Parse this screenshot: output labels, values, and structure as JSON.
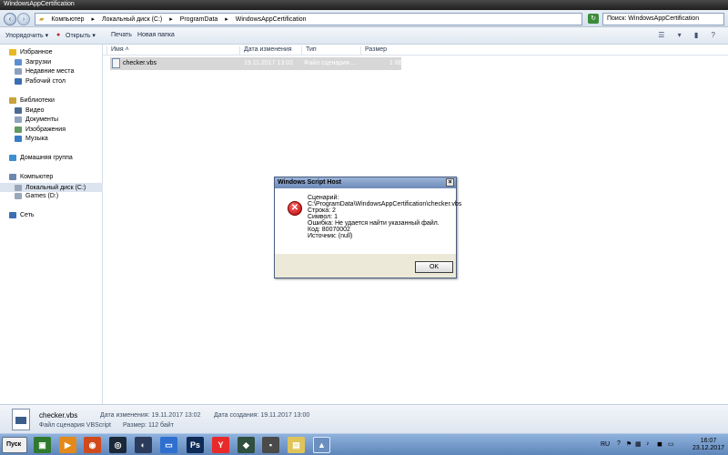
{
  "window": {
    "title": "WindowsAppCertification"
  },
  "address": {
    "crumbs": [
      "Компьютер",
      "Локальный диск (C:)",
      "ProgramData",
      "WindowsAppCertification"
    ],
    "search_placeholder": "Поиск: WindowsAppCertification"
  },
  "toolbar": {
    "organize": "Упорядочить ▾",
    "open": "Открыть ▾",
    "print": "Печать",
    "new_folder": "Новая папка"
  },
  "nav": {
    "favorites": "Избранное",
    "downloads": "Загрузки",
    "recent": "Недавние места",
    "desktop": "Рабочий стол",
    "libraries": "Библиотеки",
    "video": "Видео",
    "documents": "Документы",
    "images": "Изображения",
    "music": "Музыка",
    "homegroup": "Домашняя группа",
    "computer": "Компьютер",
    "local_disk": "Локальный диск (C:)",
    "games": "Games (D:)",
    "network": "Сеть"
  },
  "columns": {
    "name": "Имя",
    "date": "Дата изменения",
    "type": "Тип",
    "size": "Размер"
  },
  "file": {
    "name": "checker.vbs",
    "date": "19.11.2017 13:02",
    "type": "Файл сценария ...",
    "size": "1 КБ"
  },
  "dialog": {
    "title": "Windows Script Host",
    "close": "×",
    "script_label": "Сценарий:",
    "script_path": "C:\\ProgramData\\WindowsAppCertification\\checker.vbs",
    "line": "Строка:   2",
    "char": "Символ:   1",
    "error": "Ошибка: Не удается найти указанный файл.",
    "code": "Код:       80070002",
    "source": "Источник:           (null)",
    "ok": "OK"
  },
  "details": {
    "name": "checker.vbs",
    "type": "Файл сценария VBScript",
    "modified": "Дата изменения: 19.11.2017 13:02",
    "size": "Размер: 112 байт",
    "created": "Дата создания: 19.11.2017 13:00"
  },
  "taskbar": {
    "start": "Пуск",
    "lang": "RU",
    "time": "16:07",
    "date": "23.12.2017"
  }
}
